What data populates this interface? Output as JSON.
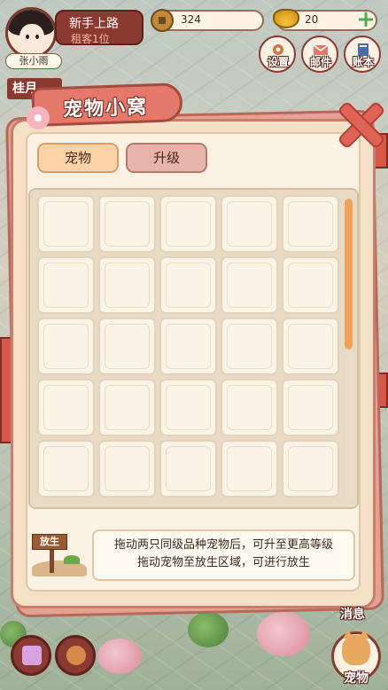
{
  "player": {
    "name": "张小雨",
    "title": "新手上路",
    "rank": "租客1位"
  },
  "resources": {
    "coins": "324",
    "ingots": "20"
  },
  "top_buttons": {
    "settings": "设置",
    "mail": "邮件",
    "ledger": "账本"
  },
  "side_tag": "桂月",
  "modal": {
    "title": "宠物小窝",
    "tabs": [
      {
        "label": "宠物",
        "active": true
      },
      {
        "label": "升级",
        "active": false
      }
    ],
    "grid": {
      "columns": 5,
      "visible_rows": 5,
      "scroll_position": 0.0
    },
    "release_sign": "放生",
    "tip_line1": "拖动两只同级品种宠物后，可升至更高等级",
    "tip_line2": "拖动宠物至放生区域，可进行放生"
  },
  "bottom_buttons": {
    "messages": "消息",
    "pet": "宠物"
  },
  "colors": {
    "accent": "#8b3a32",
    "modal_border": "#c97d6b",
    "active_tab": "#fbd3a6",
    "inactive_tab": "#e8b3a8",
    "scroll_thumb": "#f2a15a"
  }
}
